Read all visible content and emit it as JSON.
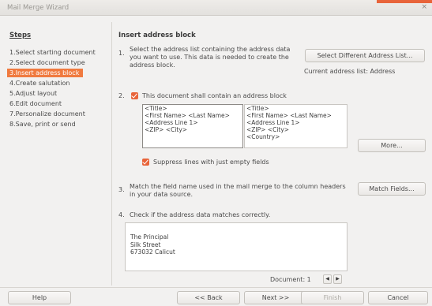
{
  "window": {
    "title": "Mail Merge Wizard",
    "close_glyph": "×"
  },
  "steps": {
    "heading": "Steps",
    "items": [
      "1.Select starting document",
      "2.Select document type",
      "3.Insert address block",
      "4.Create salutation",
      "5.Adjust layout",
      "6.Edit document",
      "7.Personalize document",
      "8.Save, print or send"
    ],
    "active_index": 2
  },
  "main": {
    "heading": "Insert address block",
    "section1": {
      "number": "1.",
      "text_lines": [
        "Select the address list containing the address data",
        "you want to use. This data is needed to create the",
        "address block."
      ],
      "button_label": "Select Different Address List...",
      "current_list": "Current address list: Address"
    },
    "section2": {
      "number": "2.",
      "checkbox_label": "This document shall contain an address block",
      "checked": true,
      "address_list": [
        "<Title>",
        "<First Name> <Last Name>",
        "<Address Line 1>",
        "<ZIP> <City>"
      ],
      "preview_list": [
        "<Title>",
        "<First Name> <Last Name>",
        "<Address Line 1>",
        "<ZIP> <City>",
        "<Country>"
      ],
      "more_label": "More...",
      "suppress_label": "Suppress lines with just empty fields",
      "suppress_checked": true
    },
    "section3": {
      "number": "3.",
      "text_lines": [
        "Match the field name used in the mail merge to the column headers",
        "in your data source."
      ],
      "button_label": "Match Fields..."
    },
    "section4": {
      "number": "4.",
      "text": "Check if the address data matches correctly.",
      "address_lines": [
        "The Principal",
        "Silk Street",
        "673032 Calicut"
      ],
      "document_label": "Document: 1",
      "prev_glyph": "◀",
      "next_glyph": "▶"
    }
  },
  "footer": {
    "help": "Help",
    "back": "<< Back",
    "next": "Next >>",
    "finish": "Finish",
    "cancel": "Cancel"
  },
  "colors": {
    "accent": "#f07a3f",
    "window_bg": "#f2f1f0"
  }
}
